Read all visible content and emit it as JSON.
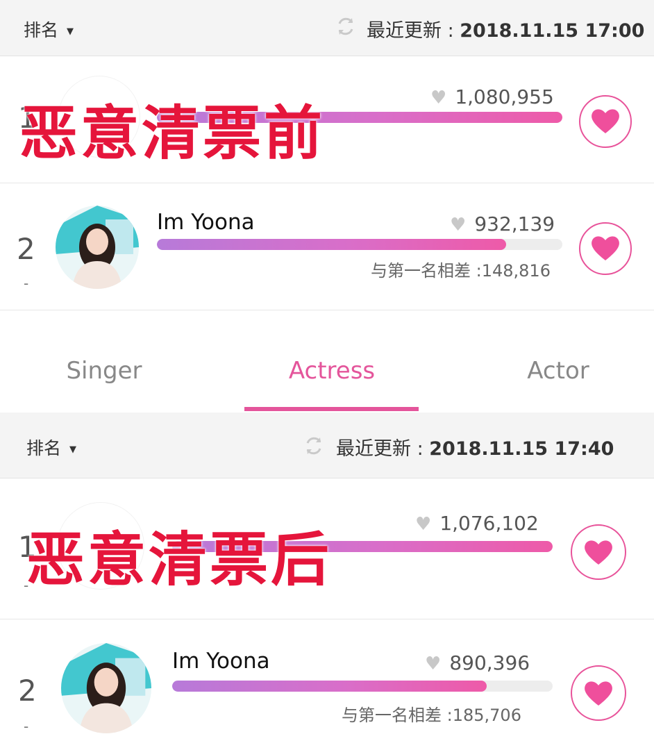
{
  "top_panel": {
    "sort_label": "排名",
    "updated_label": "最近更新 : ",
    "updated_time": "2018.11.15 17:00",
    "overlay_text": "恶意清票前",
    "rows": [
      {
        "rank": "1",
        "change": "-",
        "name": "",
        "votes": "1,080,955",
        "fill_fraction": 1.0,
        "gap": ""
      },
      {
        "rank": "2",
        "change": "-",
        "name": "Im Yoona",
        "votes": "932,139",
        "fill_fraction": 0.862,
        "gap": "与第一名相差 :148,816"
      }
    ]
  },
  "tabs": {
    "items": [
      "Singer",
      "Actress",
      "Actor"
    ],
    "active": "Actress"
  },
  "bottom_panel": {
    "sort_label": "排名",
    "updated_label": "最近更新 : ",
    "updated_time": "2018.11.15 17:40",
    "overlay_text": "恶意清票后",
    "rows": [
      {
        "rank": "1",
        "change": "-",
        "name": "",
        "votes": "1,076,102",
        "fill_fraction": 1.0,
        "gap": ""
      },
      {
        "rank": "2",
        "change": "-",
        "name": "Im Yoona",
        "votes": "890,396",
        "fill_fraction": 0.827,
        "gap": "与第一名相差 :185,706"
      }
    ]
  },
  "colors": {
    "accent": "#e4559b",
    "overlay_red": "#e5153b",
    "bar_start": "#b77ad9",
    "bar_end": "#ee5aa8"
  },
  "icons": {
    "sort": "chevron-down-icon",
    "refresh": "refresh-icon",
    "vote": "heart-icon",
    "votes": "heart-small-icon"
  }
}
